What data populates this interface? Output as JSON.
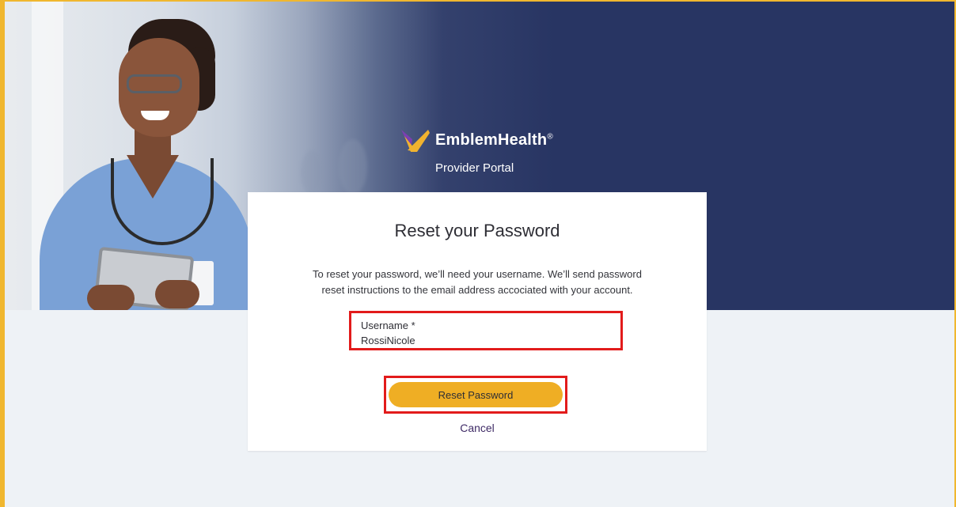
{
  "brand": {
    "name": "EmblemHealth",
    "trademark": "®",
    "subtitle": "Provider Portal",
    "logo_icon": "emblem-chevron-logo",
    "colors": {
      "logo_primary": "#f1b32f",
      "logo_secondary": "#7b3fb1"
    }
  },
  "hero": {
    "image": "nurse-with-tablet-photo",
    "background_color": "#283563"
  },
  "reset_card": {
    "title": "Reset your Password",
    "description_line1": "To reset your password, we’ll need your username. We’ll send password",
    "description_line2": "reset instructions to the email address accociated with your account.",
    "username_label": "Username *",
    "username_value": "RossiNicole",
    "submit_label": "Reset Password",
    "cancel_label": "Cancel"
  },
  "colors": {
    "accent": "#efae24",
    "highlight_outline": "#e21b1b",
    "link": "#3f2b66",
    "page_background": "#eef2f6"
  }
}
